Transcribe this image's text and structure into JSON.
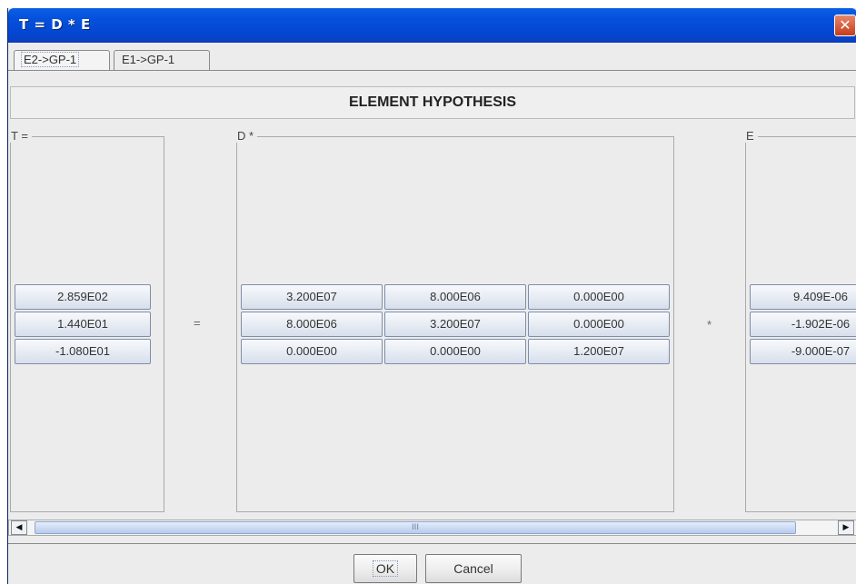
{
  "window": {
    "title": "T = D * E",
    "close_glyph": "✕"
  },
  "tabs": [
    {
      "label": "E2->GP-1",
      "active": true
    },
    {
      "label": "E1->GP-1",
      "active": false
    }
  ],
  "header": {
    "title": "ELEMENT HYPOTHESIS"
  },
  "groups": {
    "t": {
      "label": "T =",
      "values": [
        "2.859E02",
        "1.440E01",
        "-1.080E01"
      ]
    },
    "d": {
      "label": "D *",
      "rows": [
        [
          "3.200E07",
          "8.000E06",
          "0.000E00"
        ],
        [
          "8.000E06",
          "3.200E07",
          "0.000E00"
        ],
        [
          "0.000E00",
          "0.000E00",
          "1.200E07"
        ]
      ]
    },
    "e": {
      "label": "E",
      "values": [
        "9.409E-06",
        "-1.902E-06",
        "-9.000E-07"
      ]
    }
  },
  "operators": {
    "equals": "=",
    "multiply": "*"
  },
  "scrollbar": {
    "left_icon": "arrow-left-icon",
    "right_icon": "arrow-right-icon",
    "left_glyph": "◀",
    "right_glyph": "▶",
    "grip": "III"
  },
  "buttons": {
    "ok": "OK",
    "cancel": "Cancel"
  }
}
